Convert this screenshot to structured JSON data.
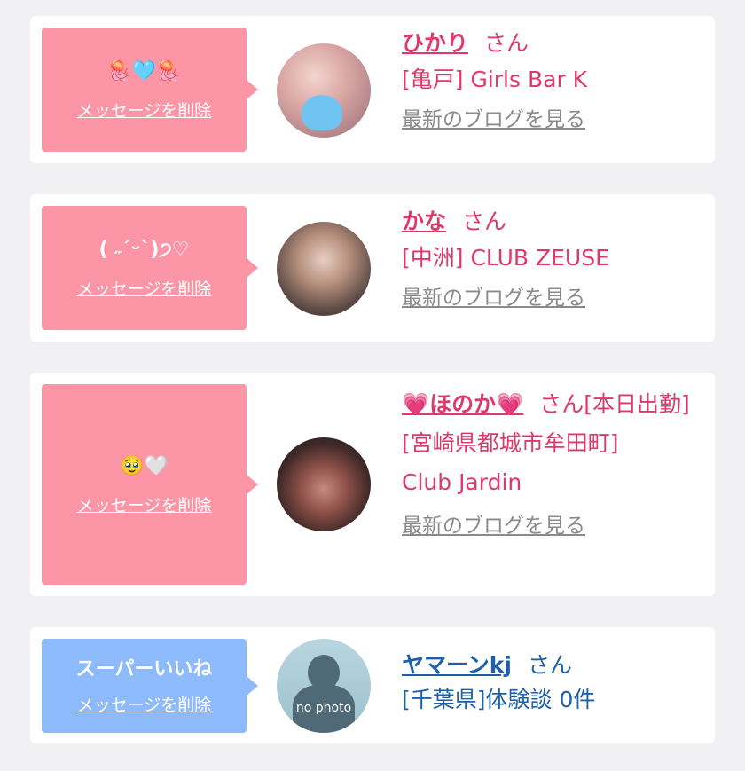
{
  "delete_label": "メッセージを削除",
  "blog_label": "最新のブログを見る",
  "honorific": "さん",
  "entries": [
    {
      "message": "🪼🩵🪼",
      "name": "ひかり",
      "suffix": "",
      "shop": "[亀戸] Girls Bar K"
    },
    {
      "message": "( ˶ˊᵕˋ)੭♡",
      "name": "かな",
      "suffix": "",
      "shop": "[中洲] CLUB ZEUSE"
    },
    {
      "message": "🥹🤍",
      "name": "💗ほのか💗",
      "suffix": "[本日出勤]",
      "shop": "[宮崎県都城市牟田町] Club Jardin"
    },
    {
      "message": "スーパーいいね",
      "name": "ヤマーンkj",
      "suffix": "",
      "shop": "[千葉県]体験談 0件",
      "avatar_text": "no photo"
    }
  ],
  "colors": {
    "pink_bubble": "#fc95a6",
    "blue_bubble": "#8dbafb",
    "pink_text": "#e0386b",
    "blue_text": "#1d5fa9"
  }
}
